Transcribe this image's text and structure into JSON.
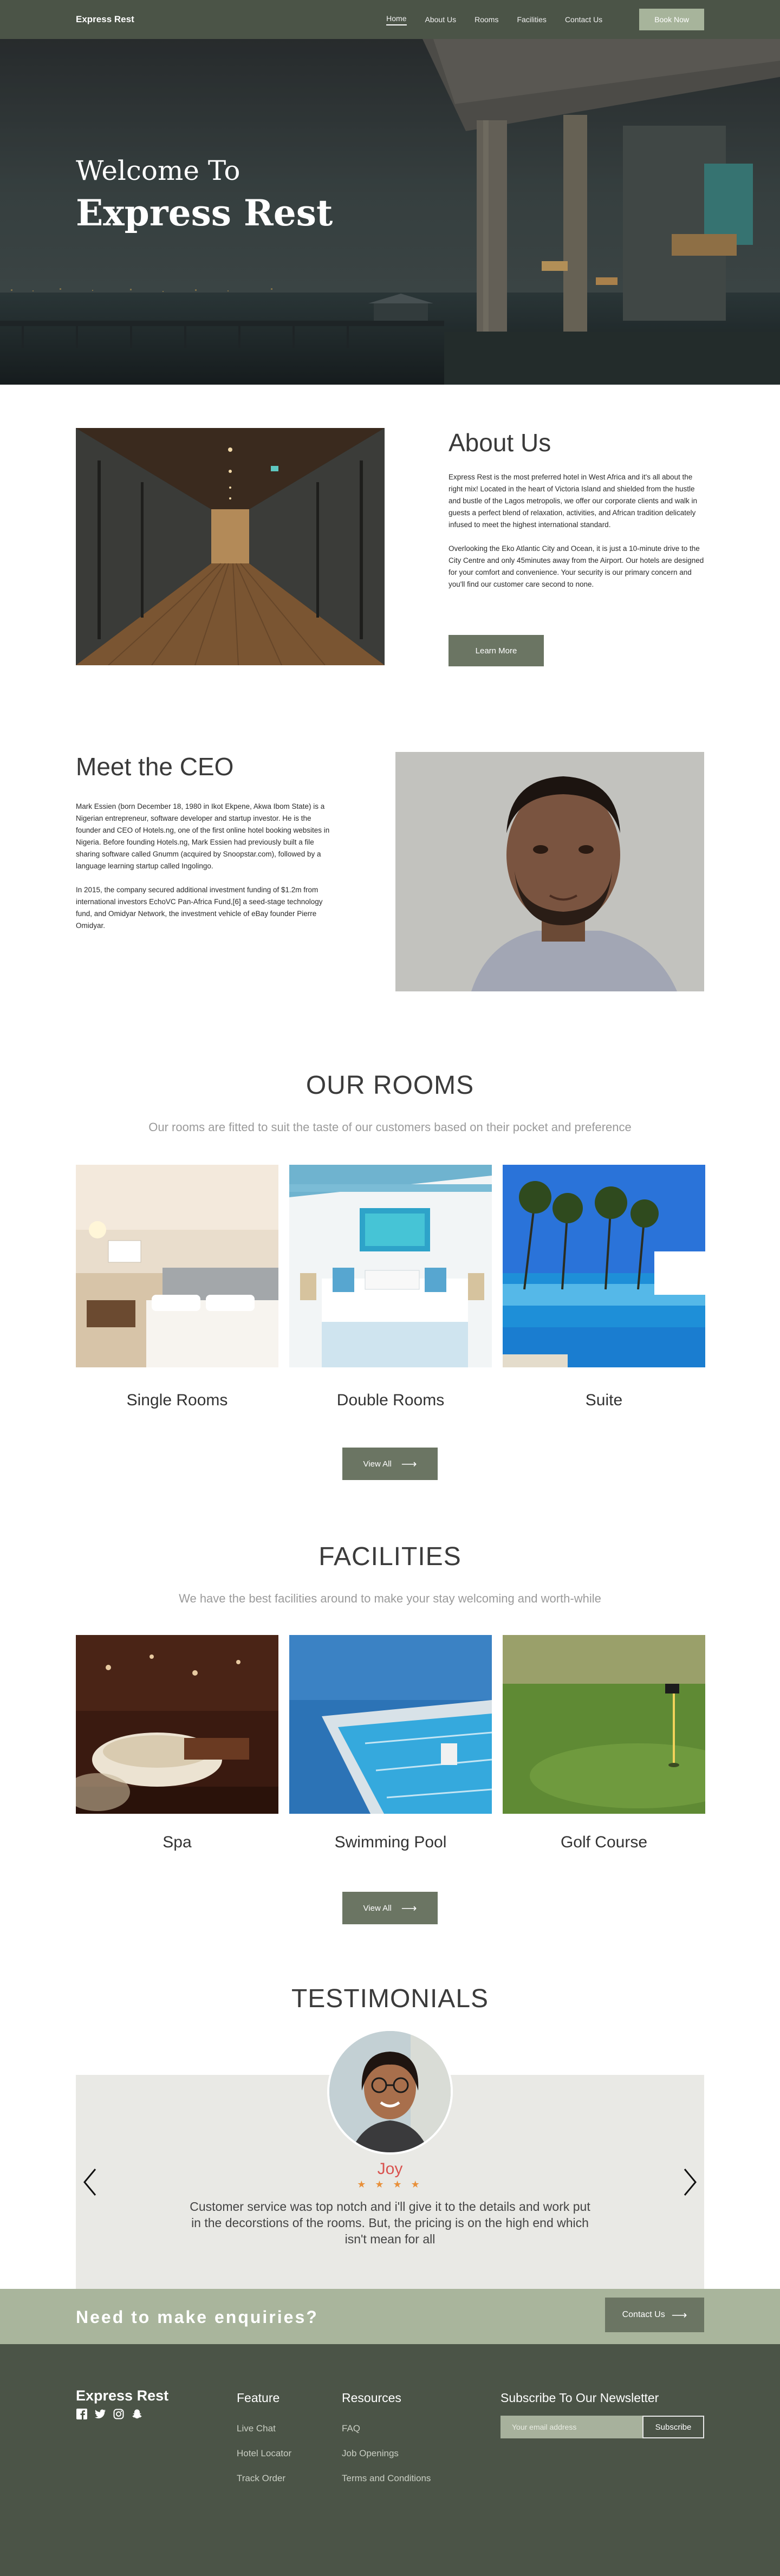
{
  "nav": {
    "brand": "Express Rest",
    "links": [
      "Home",
      "About Us",
      "Rooms",
      "Facilities",
      "Contact Us"
    ],
    "book_label": "Book Now"
  },
  "hero": {
    "line1": "Welcome To",
    "line2": "Express Rest"
  },
  "about": {
    "title": "About Us",
    "paragraphs": [
      "Express Rest is the most preferred hotel in West Africa and it's all about the right mix! Located in the heart of Victoria Island and shielded from the hustle and bustle of the Lagos metropolis, we offer our corporate clients and walk in guests a perfect blend of relaxation, activities, and African tradition delicately infused to meet the highest international standard.",
      "Overlooking the Eko Atlantic City and Ocean, it is just a 10-minute drive to the City Centre and only 45minutes away from the Airport. Our hotels are designed for your comfort and convenience. Your security is our primary concern and you'll find our customer care second to none."
    ],
    "button": "Learn More"
  },
  "ceo": {
    "title": "Meet the CEO",
    "paragraphs": [
      "Mark Essien (born December 18, 1980 in Ikot Ekpene, Akwa Ibom State) is a Nigerian entrepreneur, software developer and startup investor. He is the founder and CEO of Hotels.ng, one of the first online hotel booking websites in Nigeria. Before founding Hotels.ng, Mark Essien had previously built a file sharing software called Gnumm (acquired by Snoopstar.com), followed by a language learning startup called Ingolingo.",
      "In 2015, the company secured additional investment funding of $1.2m from international investors EchoVC Pan-Africa Fund,[6] a seed-stage technology fund, and Omidyar Network, the investment vehicle of eBay founder Pierre Omidyar."
    ]
  },
  "rooms": {
    "title": "OUR ROOMS",
    "subtitle": "Our rooms are fitted to suit the taste of our customers based on their pocket and preference",
    "items": [
      "Single Rooms",
      "Double Rooms",
      "Suite"
    ],
    "button": "View All"
  },
  "facilities": {
    "title": "FACILITIES",
    "subtitle": "We have the best facilities around to make your stay welcoming and worth-while",
    "items": [
      "Spa",
      "Swimming Pool",
      "Golf Course"
    ],
    "button": "View All"
  },
  "testimonials": {
    "title": "TESTIMONIALS",
    "name": "Joy",
    "stars": "★ ★ ★ ★",
    "quote": "Customer service was top notch and i'll give it to the details and work put in the decorstions of the rooms. But, the pricing is on the high end which isn't mean for all"
  },
  "enquiry": {
    "text": "Need to make enquiries?",
    "button": "Contact Us"
  },
  "footer": {
    "brand": "Express Rest",
    "feature_title": "Feature",
    "feature_links": [
      "Live Chat",
      "Hotel Locator",
      "Track Order"
    ],
    "resources_title": "Resources",
    "resources_links": [
      "FAQ",
      "Job Openings",
      "Terms and Conditions"
    ],
    "newsletter_title": "Subscribe To Our Newsletter",
    "email_placeholder": "Your email address",
    "subscribe": "Subscribe",
    "social_icons": [
      "facebook-icon",
      "twitter-icon",
      "instagram-icon",
      "snapchat-icon"
    ]
  },
  "colors": {
    "nav_bg": "#4b5447",
    "accent": "#a7b49b",
    "button": "#6b7563",
    "star": "#e8903a",
    "name": "#d9534f"
  }
}
